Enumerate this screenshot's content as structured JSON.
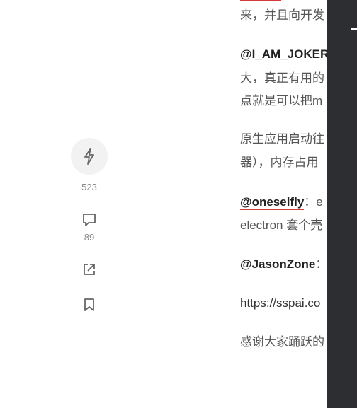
{
  "article": {
    "line1": "来，并且向开发",
    "comment1_author": "@I_AM_JOKER",
    "line3": "大，真正有用的",
    "line4": "点就是可以把m",
    "line5": "原生应用启动往",
    "line6": "器），内存占用",
    "comment2_author": "@oneselfly",
    "comment2_tail": "：e",
    "line8": "electron 套个壳",
    "comment3_author": "@JasonZone",
    "comment3_tail": "：",
    "link": "https://sspai.co",
    "thanks": "感谢大家踊跃的"
  },
  "actions": {
    "like_count": "523",
    "comment_count": "89"
  },
  "icons": {
    "like": "lightning-icon",
    "comment": "comment-bubble-icon",
    "share": "share-icon",
    "bookmark": "bookmark-icon"
  },
  "colors": {
    "accent": "#d63a3a",
    "panel": "#2d2e31"
  }
}
